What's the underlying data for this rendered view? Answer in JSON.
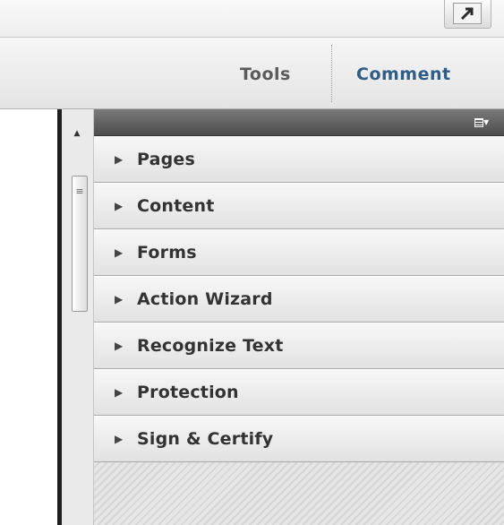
{
  "toolbar": {
    "share_icon": "share-arrow-icon",
    "tabs": [
      {
        "label": "Tools"
      },
      {
        "label": "Comment"
      }
    ]
  },
  "scrollbar": {
    "up_icon": "up-arrow-icon",
    "grip_icon": "grip-icon"
  },
  "panel": {
    "options_icon": "panel-options-menu-icon",
    "sections": [
      {
        "label": "Pages"
      },
      {
        "label": "Content"
      },
      {
        "label": "Forms"
      },
      {
        "label": "Action Wizard"
      },
      {
        "label": "Recognize Text"
      },
      {
        "label": "Protection"
      },
      {
        "label": "Sign & Certify"
      }
    ]
  },
  "colors": {
    "accent": "#2f5d86",
    "panel_header": "#5a5a5a",
    "section_text": "#333333"
  }
}
